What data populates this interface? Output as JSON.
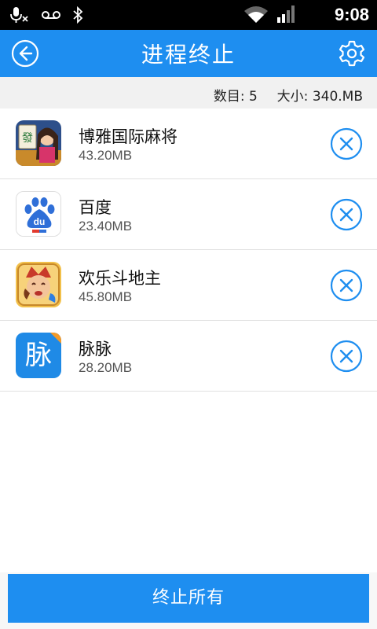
{
  "status_bar": {
    "time": "9:08",
    "icons": [
      "mic-muted-icon",
      "voicemail-icon",
      "bluetooth-icon",
      "wifi-icon",
      "signal-icon"
    ]
  },
  "header": {
    "title": "进程终止",
    "back_icon": "back-arrow-icon",
    "settings_icon": "gear-icon"
  },
  "summary": {
    "count_label": "数目:",
    "count_value": "5",
    "size_label": "大小:",
    "size_value": "340.MB"
  },
  "apps": [
    {
      "name": "博雅国际麻将",
      "size": "43.20MB"
    },
    {
      "name": "百度",
      "size": "23.40MB"
    },
    {
      "name": "欢乐斗地主",
      "size": "45.80MB"
    },
    {
      "name": "脉脉",
      "size": "28.20MB",
      "icon_text": "脉"
    }
  ],
  "footer": {
    "end_all_label": "终止所有"
  },
  "colors": {
    "accent": "#1e8ef0",
    "kill_icon": "#1e8ef0"
  }
}
